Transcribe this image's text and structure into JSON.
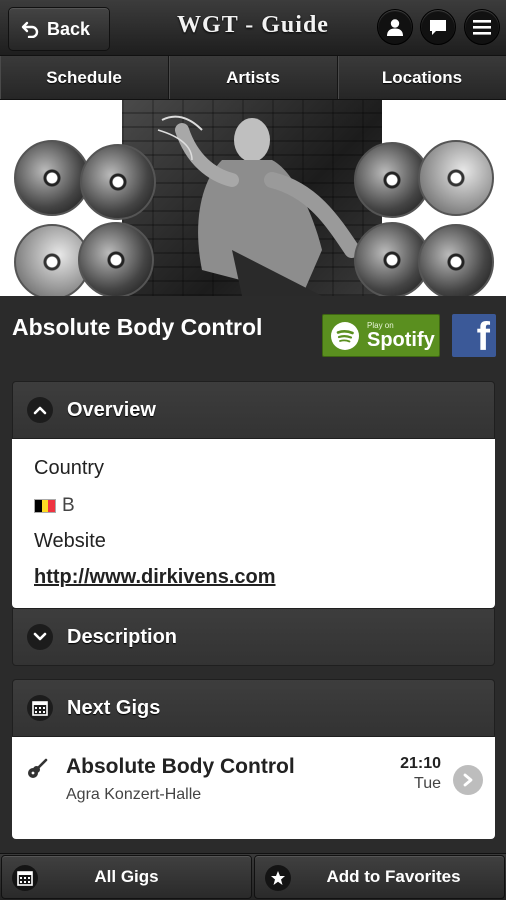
{
  "header": {
    "back_label": "Back",
    "title": "WGT - Guide",
    "icons": [
      "user-icon",
      "chat-icon",
      "menu-icon"
    ]
  },
  "nav": {
    "tabs": [
      {
        "label": "Schedule"
      },
      {
        "label": "Artists"
      },
      {
        "label": "Locations"
      }
    ]
  },
  "artist": {
    "name": "Absolute Body Control",
    "spotify_small": "Play on",
    "spotify_big": "Spotify",
    "facebook_glyph": "f"
  },
  "overview": {
    "title": "Overview",
    "country_label": "Country",
    "country_value": "B",
    "website_label": "Website",
    "website_value": "http://www.dirkivens.com"
  },
  "description": {
    "title": "Description"
  },
  "next_gigs": {
    "title": "Next Gigs",
    "items": [
      {
        "title": "Absolute Body Control",
        "venue": "Agra Konzert-Halle",
        "time": "21:10",
        "day": "Tue"
      }
    ]
  },
  "bottom": {
    "all_gigs_label": "All Gigs",
    "favorites_label": "Add to Favorites"
  },
  "colors": {
    "spotify_green": "#5a8f1f",
    "facebook_blue": "#3b5998",
    "flag_black": "#000000",
    "flag_yellow": "#fdda24",
    "flag_red": "#ef3340"
  }
}
